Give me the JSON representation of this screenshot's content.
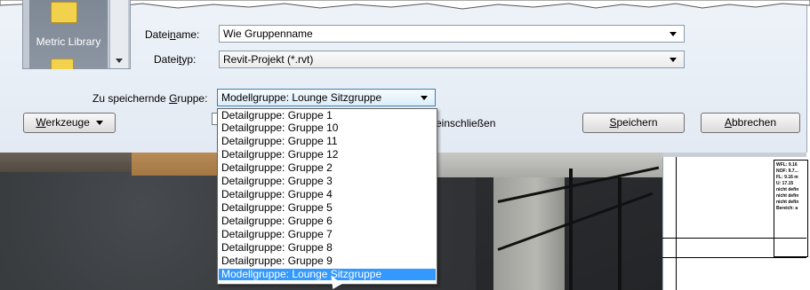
{
  "library": {
    "label": "Metric Library"
  },
  "filename": {
    "label_pre": "Datei",
    "label_u": "n",
    "label_post": "ame:",
    "value": "Wie Gruppenname"
  },
  "filetype": {
    "label_pre": "Datei",
    "label_u": "t",
    "label_post": "yp:",
    "value": "Revit-Projekt  (*.rvt)"
  },
  "group": {
    "label_pre": "Zu speichernde ",
    "label_u": "G",
    "label_post": "ruppe:",
    "selected": "Modellgruppe: Lounge Sitzgruppe"
  },
  "tools_button": {
    "label_u": "W",
    "label_post": "erkzeuge"
  },
  "include_label": "einschließen",
  "save_button": {
    "label_u": "S",
    "label_post": "peichern"
  },
  "cancel_button": {
    "label_u": "A",
    "label_post": "bbrechen"
  },
  "options": [
    "Detailgruppe: Gruppe 1",
    "Detailgruppe: Gruppe 10",
    "Detailgruppe: Gruppe 11",
    "Detailgruppe: Gruppe 12",
    "Detailgruppe: Gruppe 2",
    "Detailgruppe: Gruppe 3",
    "Detailgruppe: Gruppe 4",
    "Detailgruppe: Gruppe 5",
    "Detailgruppe: Gruppe 6",
    "Detailgruppe: Gruppe 7",
    "Detailgruppe: Gruppe 8",
    "Detailgruppe: Gruppe 9",
    "Modellgruppe: Lounge Sitzgruppe"
  ],
  "plan_text": [
    "WFL: 9.16",
    "NOF: 9.7...",
    "FL: 9.16 m",
    "U: 17.15",
    "nicht defin",
    "nicht defin",
    "nicht defin",
    "Bereich: a"
  ],
  "colors": {
    "selection": "#3399ff",
    "dialog_bg": "#e8eef5"
  }
}
